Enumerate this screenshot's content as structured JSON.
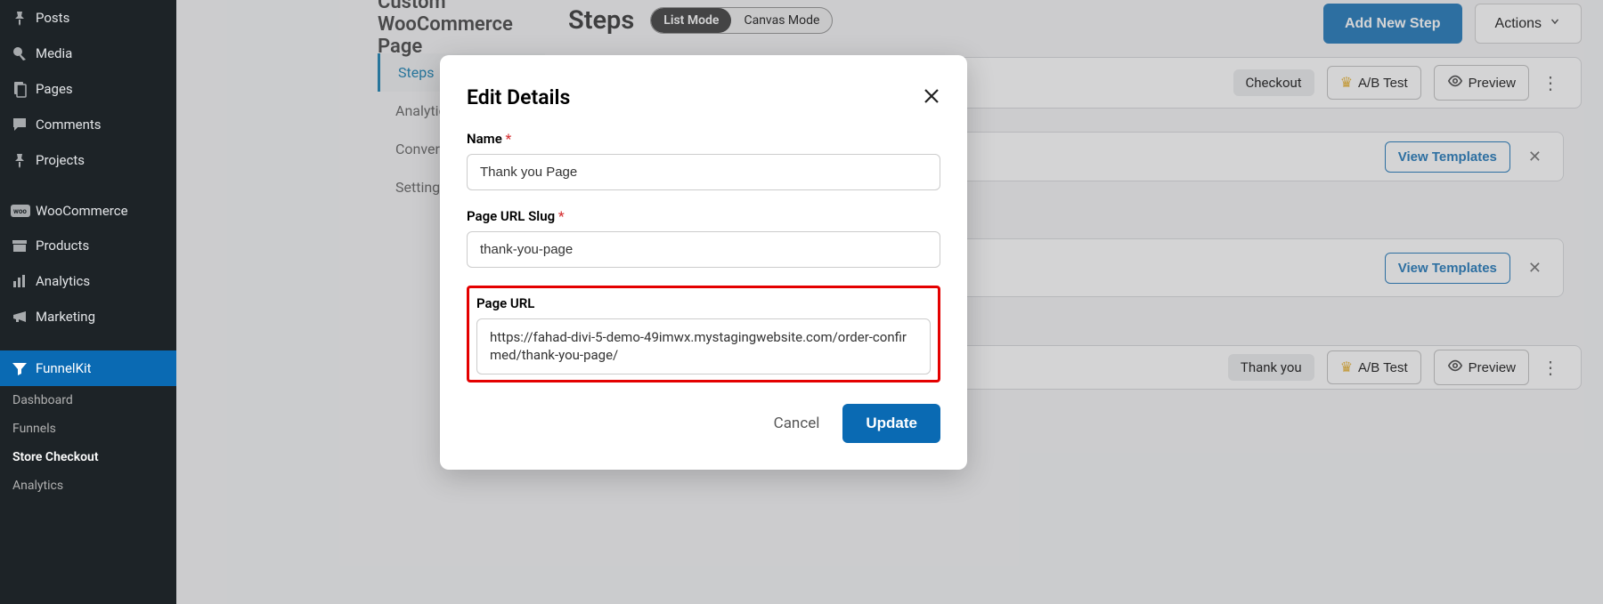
{
  "wp_menu": {
    "posts": "Posts",
    "media": "Media",
    "pages": "Pages",
    "comments": "Comments",
    "projects": "Projects",
    "woocommerce": "WooCommerce",
    "products": "Products",
    "analytics": "Analytics",
    "marketing": "Marketing",
    "funnelkit": "FunnelKit"
  },
  "fk_submenu": {
    "dashboard": "Dashboard",
    "funnels": "Funnels",
    "store_checkout": "Store Checkout",
    "analytics": "Analytics"
  },
  "page_title": "Custom WooCommerce Page",
  "section_tabs": {
    "steps": "Steps",
    "analytics": "Analytics",
    "conversions": "Conversions",
    "settings": "Settings"
  },
  "steps": {
    "heading": "Steps",
    "mode_list": "List Mode",
    "mode_canvas": "Canvas Mode"
  },
  "header_actions": {
    "add_new": "Add New Step",
    "actions": "Actions"
  },
  "badges": {
    "checkout": "Checkout",
    "thank_you": "Thank you"
  },
  "buttons": {
    "ab_test": "A/B Test",
    "preview": "Preview",
    "view_templates": "View Templates"
  },
  "modal": {
    "title": "Edit Details",
    "name_label": "Name",
    "name_value": "Thank you Page",
    "slug_label": "Page URL Slug",
    "slug_value": "thank-you-page",
    "url_label": "Page URL",
    "url_value": "https://fahad-divi-5-demo-49imwx.mystagingwebsite.com/order-confirmed/thank-you-page/",
    "cancel": "Cancel",
    "update": "Update"
  }
}
